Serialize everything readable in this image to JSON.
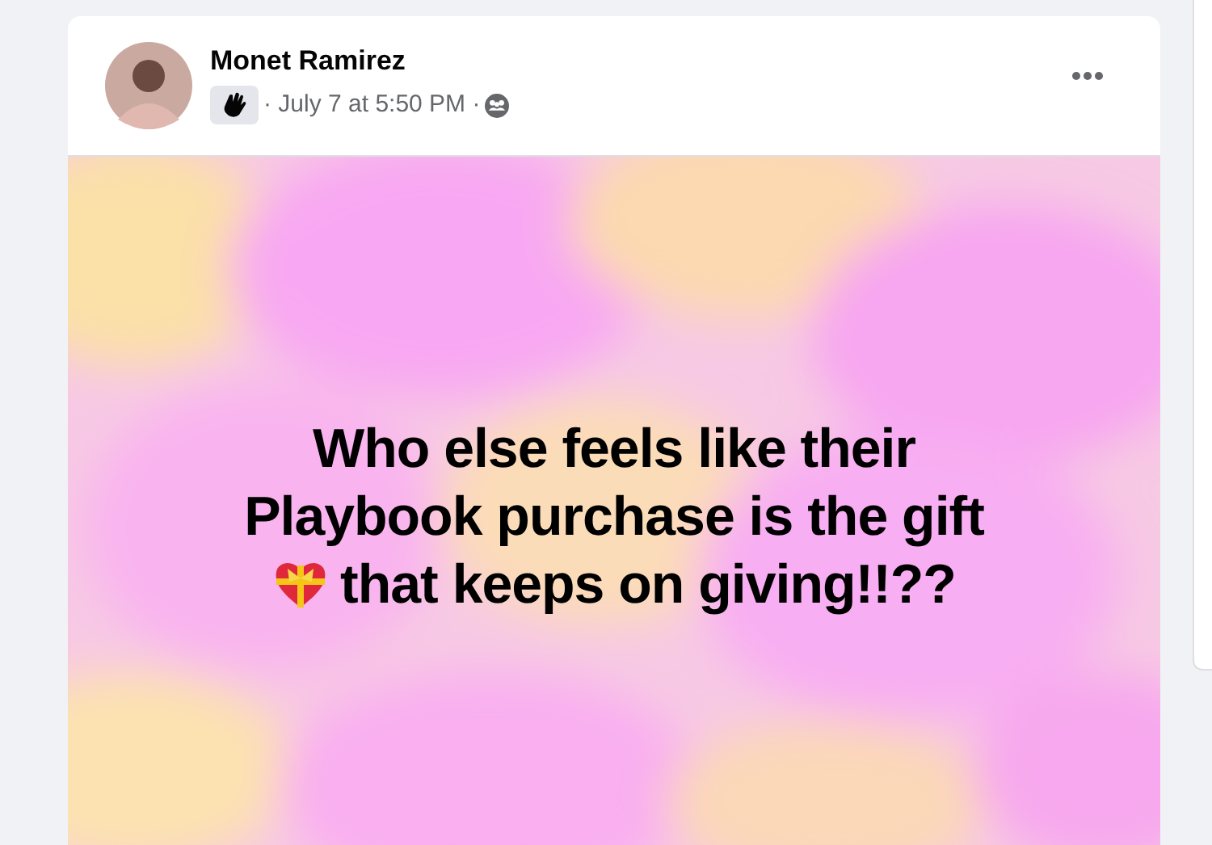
{
  "post": {
    "author": "Monet Ramirez",
    "meta": "· July 7 at 5:50 PM ·",
    "image": {
      "caption_lines": [
        "Who else feels like their",
        "Playbook purchase is the gift",
        "that keeps on giving!!??"
      ]
    }
  }
}
